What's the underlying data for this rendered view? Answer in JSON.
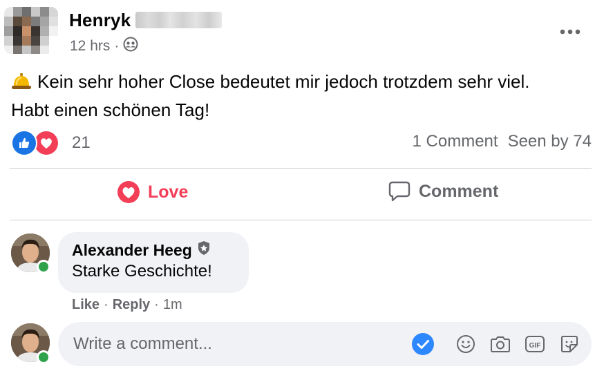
{
  "post": {
    "author_name": "Henryk",
    "time": "12 hrs",
    "meta_separator": "·",
    "audience_icon": "friends-icon",
    "text_line1": "Kein sehr hoher Close bedeutet mir jedoch trotzdem sehr viel.",
    "text_line2": "Habt einen schönen Tag!",
    "emoji_icon": "bell-icon"
  },
  "reactions": {
    "count": "21",
    "types": [
      "like",
      "love"
    ],
    "comments_label": "1 Comment",
    "seen_label": "Seen by 74"
  },
  "actions": {
    "love_label": "Love",
    "comment_label": "Comment"
  },
  "comment": {
    "name": "Alexander Heeg",
    "badge_icon": "shield-badge-icon",
    "text": "Starke Geschichte!",
    "like_label": "Like",
    "reply_label": "Reply",
    "time": "1m",
    "sep": "·"
  },
  "composer": {
    "placeholder": "Write a comment...",
    "tools": [
      "check-icon",
      "emoji-icon",
      "camera-icon",
      "gif-icon",
      "sticker-icon"
    ]
  },
  "colors": {
    "love": "#f33e58",
    "like": "#1b74e4",
    "muted": "#65676b",
    "bubble": "#f0f2f5",
    "online": "#31a24c"
  }
}
